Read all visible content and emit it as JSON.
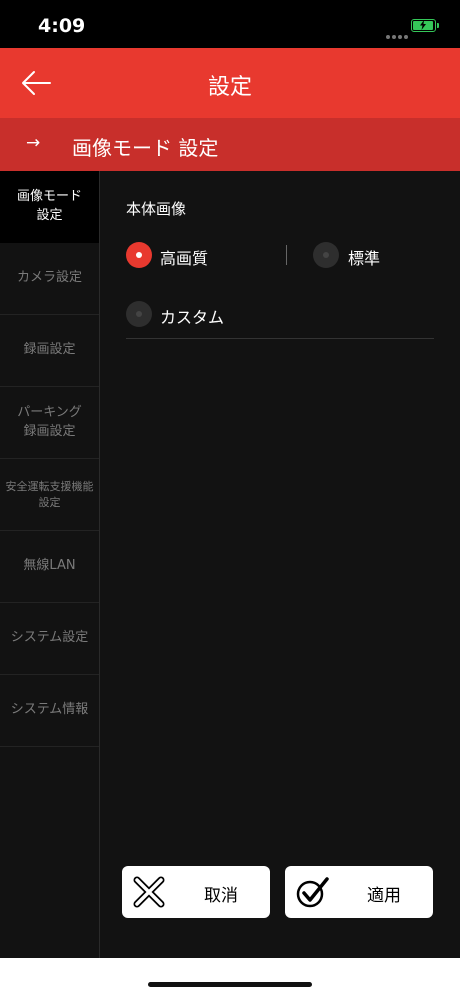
{
  "status_bar": {
    "time": "4:09",
    "battery_level": 0.85,
    "battery_color": "#35c759"
  },
  "header": {
    "title": "設定",
    "back_icon": "arrow-left-icon",
    "color": "#e8392f"
  },
  "sub_header": {
    "arrow": "→",
    "title": "画像モード 設定",
    "color": "#c82f2b"
  },
  "sidebar": {
    "items": [
      {
        "label": "画像モード\n設定",
        "active": true
      },
      {
        "label": "カメラ設定",
        "active": false
      },
      {
        "label": "録画設定",
        "active": false
      },
      {
        "label": "パーキング\n録画設定",
        "active": false
      },
      {
        "label": "安全運転支援機能\n設定",
        "active": false
      },
      {
        "label": "無線LAN",
        "active": false
      },
      {
        "label": "システム設定",
        "active": false
      },
      {
        "label": "システム情報",
        "active": false
      }
    ]
  },
  "main": {
    "section_title": "本体画像",
    "options": [
      {
        "label": "高画質",
        "selected": true
      },
      {
        "label": "標準",
        "selected": false
      },
      {
        "label": "カスタム",
        "selected": false
      }
    ]
  },
  "buttons": {
    "cancel_label": "取消",
    "apply_label": "適用"
  }
}
